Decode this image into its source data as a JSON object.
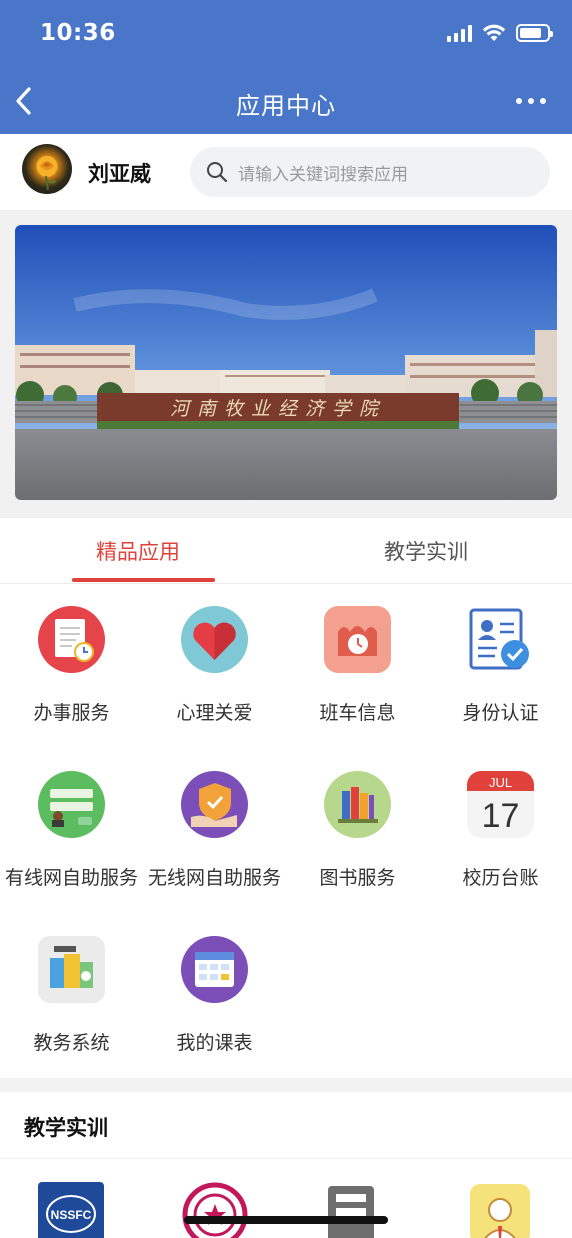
{
  "status_bar": {
    "time": "10:36",
    "signal_icon": "cellular-signal-icon",
    "wifi_icon": "wifi-icon",
    "battery_icon": "battery-icon",
    "battery_level": 0.8
  },
  "nav": {
    "title": "应用中心",
    "back_icon": "chevron-left-icon",
    "more_icon": "more-dots-icon"
  },
  "user": {
    "name": "刘亚威",
    "avatar_icon": "rose-avatar"
  },
  "search": {
    "placeholder": "请输入关键词搜索应用",
    "icon": "search-icon"
  },
  "banner": {
    "sign_text": "河南牧业经济学院"
  },
  "tabs": [
    {
      "label": "精品应用",
      "active": true
    },
    {
      "label": "教学实训",
      "active": false
    }
  ],
  "apps": [
    {
      "label": "办事服务",
      "icon": "document-clock-icon"
    },
    {
      "label": "心理关爱",
      "icon": "heart-icon"
    },
    {
      "label": "班车信息",
      "icon": "bus-schedule-icon"
    },
    {
      "label": "身份认证",
      "icon": "id-card-check-icon"
    },
    {
      "label": "有线网自助服务",
      "icon": "wired-network-icon"
    },
    {
      "label": "无线网自助服务",
      "icon": "wireless-shield-icon"
    },
    {
      "label": "图书服务",
      "icon": "books-icon"
    },
    {
      "label": "校历台账",
      "icon": "calendar-icon"
    },
    {
      "label": "教务系统",
      "icon": "academic-system-icon"
    },
    {
      "label": "我的课表",
      "icon": "timetable-icon"
    }
  ],
  "calendar_icon": {
    "month": "JUL",
    "day": "17"
  },
  "section2": {
    "title": "教学实训",
    "apps": [
      {
        "icon": "nssfc-logo-icon",
        "badge_text": "NSSFC"
      },
      {
        "icon": "emblem-icon"
      },
      {
        "icon": "printer-icon"
      },
      {
        "icon": "user-avatar-icon"
      }
    ]
  },
  "colors": {
    "nav_bg": "#4a76c9",
    "accent": "#e0413b"
  }
}
